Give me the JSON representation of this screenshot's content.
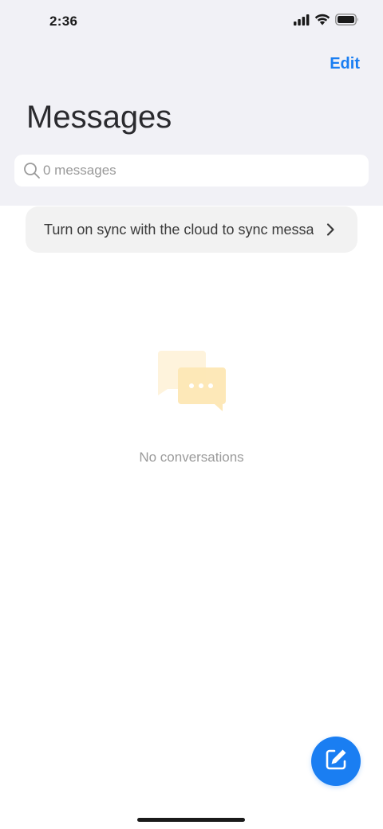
{
  "status_bar": {
    "time": "2:36",
    "icons": [
      "signal-icon",
      "wifi-icon",
      "battery-icon"
    ]
  },
  "header": {
    "edit_label": "Edit",
    "title": "Messages"
  },
  "search": {
    "placeholder": "0 messages",
    "value": ""
  },
  "sync_banner": {
    "text": "Turn on sync with the cloud to sync messages"
  },
  "empty_state": {
    "text": "No conversations",
    "icon": "chat-bubbles-icon"
  },
  "fab": {
    "icon": "compose-icon"
  },
  "colors": {
    "accent": "#1a7ef2",
    "header_bg": "#f1f1f6",
    "banner_bg": "#f2f2f2",
    "illustration": "#fde9b8"
  }
}
